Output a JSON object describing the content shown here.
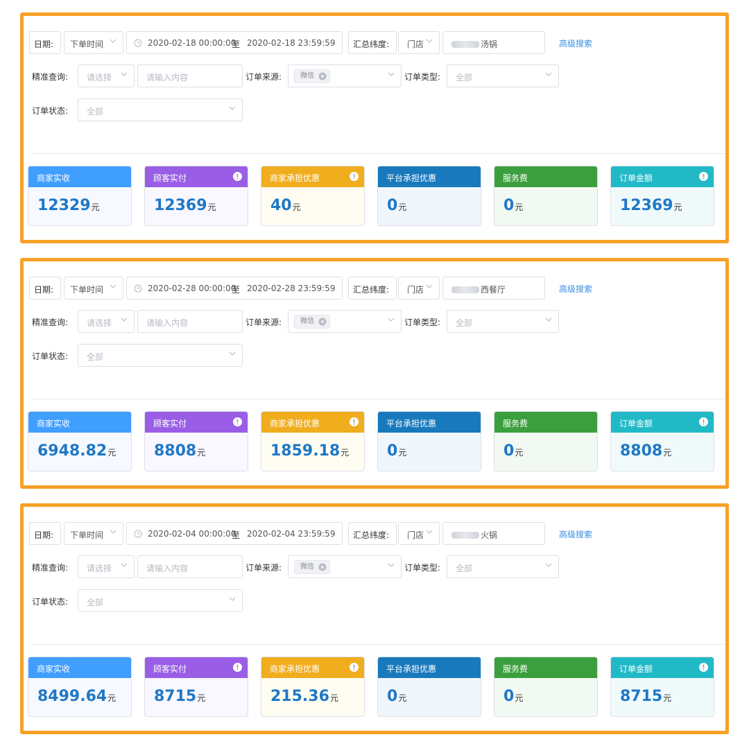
{
  "labels": {
    "date": "日期:",
    "range_sep": "至",
    "dimension": "汇总纬度:",
    "precise_query": "精准查询:",
    "order_source": "订单来源:",
    "order_type": "订单类型:",
    "order_status": "订单状态:",
    "advanced_search": "高级搜索",
    "unit": "元"
  },
  "panels": [
    {
      "time_type": "下单时间",
      "date_range": "2020-02-18 00:00:00",
      "date_end": "2020-02-18 23:59:59",
      "dimension_value": "门店",
      "store_name": "汤锅",
      "select_placeholder": "请选择",
      "input_placeholder": "请输入内容",
      "source_tag": "微信",
      "order_type_value": "全部",
      "order_status_value": "全部",
      "cards": [
        {
          "title": "商家实收",
          "value": "12329",
          "color": "#409eff",
          "bg": "#f6f9ff",
          "warn": false
        },
        {
          "title": "顾客实付",
          "value": "12369",
          "color": "#9a5ee6",
          "bg": "#f9f7ff",
          "warn": true
        },
        {
          "title": "商家承担优惠",
          "value": "40",
          "color": "#f0ad1e",
          "bg": "#fffdf2",
          "warn": true
        },
        {
          "title": "平台承担优惠",
          "value": "0",
          "color": "#1979bd",
          "bg": "#f0f7fc",
          "warn": false
        },
        {
          "title": "服务费",
          "value": "0",
          "color": "#3c9f3d",
          "bg": "#f2f9f2",
          "warn": false
        },
        {
          "title": "订单金额",
          "value": "12369",
          "color": "#22b9c7",
          "bg": "#f0fafb",
          "warn": true
        }
      ]
    },
    {
      "time_type": "下单时间",
      "date_range": "2020-02-28 00:00:00",
      "date_end": "2020-02-28 23:59:59",
      "dimension_value": "门店",
      "store_name": "西餐厅",
      "select_placeholder": "请选择",
      "input_placeholder": "请输入内容",
      "source_tag": "微信",
      "order_type_value": "全部",
      "order_status_value": "全部",
      "cards": [
        {
          "title": "商家实收",
          "value": "6948.82",
          "color": "#409eff",
          "bg": "#f6f9ff",
          "warn": false
        },
        {
          "title": "顾客实付",
          "value": "8808",
          "color": "#9a5ee6",
          "bg": "#f9f7ff",
          "warn": true
        },
        {
          "title": "商家承担优惠",
          "value": "1859.18",
          "color": "#f0ad1e",
          "bg": "#fffdf2",
          "warn": true
        },
        {
          "title": "平台承担优惠",
          "value": "0",
          "color": "#1979bd",
          "bg": "#f0f7fc",
          "warn": false
        },
        {
          "title": "服务费",
          "value": "0",
          "color": "#3c9f3d",
          "bg": "#f2f9f2",
          "warn": false
        },
        {
          "title": "订单金额",
          "value": "8808",
          "color": "#22b9c7",
          "bg": "#f0fafb",
          "warn": true
        }
      ]
    },
    {
      "time_type": "下单时间",
      "date_range": "2020-02-04 00:00:00",
      "date_end": "2020-02-04 23:59:59",
      "dimension_value": "门店",
      "store_name": "火锅",
      "select_placeholder": "请选择",
      "input_placeholder": "请输入内容",
      "source_tag": "微信",
      "order_type_value": "全部",
      "order_status_value": "全部",
      "cards": [
        {
          "title": "商家实收",
          "value": "8499.64",
          "color": "#409eff",
          "bg": "#f6f9ff",
          "warn": false
        },
        {
          "title": "顾客实付",
          "value": "8715",
          "color": "#9a5ee6",
          "bg": "#f9f7ff",
          "warn": true
        },
        {
          "title": "商家承担优惠",
          "value": "215.36",
          "color": "#f0ad1e",
          "bg": "#fffdf2",
          "warn": true
        },
        {
          "title": "平台承担优惠",
          "value": "0",
          "color": "#1979bd",
          "bg": "#f0f7fc",
          "warn": false
        },
        {
          "title": "服务费",
          "value": "0",
          "color": "#3c9f3d",
          "bg": "#f2f9f2",
          "warn": false
        },
        {
          "title": "订单金额",
          "value": "8715",
          "color": "#22b9c7",
          "bg": "#f0fafb",
          "warn": true
        }
      ]
    }
  ]
}
